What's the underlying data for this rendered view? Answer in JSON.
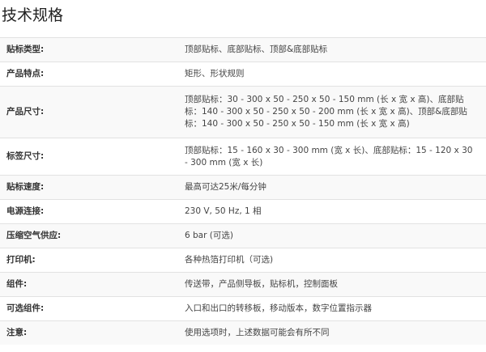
{
  "title": "技术规格",
  "rows": [
    {
      "label": "贴标类型:",
      "value": "顶部贴标、底部贴标、顶部&底部贴标"
    },
    {
      "label": "产品特点:",
      "value": "矩形、形状规则"
    },
    {
      "label": "产品尺寸:",
      "value": "顶部贴标：30 - 300 x 50 - 250 x 50 - 150 mm (长 x 宽 x 高)、底部贴标：140 - 300 x 50 - 250 x 50 - 200 mm (长 x 宽 x 高)、顶部&底部贴标：140 - 300 x 50 - 250 x 50 - 150 mm (长 x 宽 x 高)"
    },
    {
      "label": "标签尺寸:",
      "value": "顶部贴标：15 - 160 x 30 - 300 mm (宽 x 长)、底部贴标：15 - 120 x 30 - 300 mm (宽 x 长)"
    },
    {
      "label": "贴标速度:",
      "value": "最高可达25米/每分钟"
    },
    {
      "label": "电源连接:",
      "value": "230 V, 50 Hz, 1 相"
    },
    {
      "label": "压缩空气供应:",
      "value": "6 bar (可选)"
    },
    {
      "label": "打印机:",
      "value": "各种热箔打印机（可选)"
    },
    {
      "label": "组件:",
      "value": "传送带，产品侧导板，贴标机，控制面板"
    },
    {
      "label": "可选组件:",
      "value": "入口和出口的转移板，移动版本，数字位置指示器"
    },
    {
      "label": "注意:",
      "value": "使用选项时，上述数据可能会有所不同"
    }
  ]
}
